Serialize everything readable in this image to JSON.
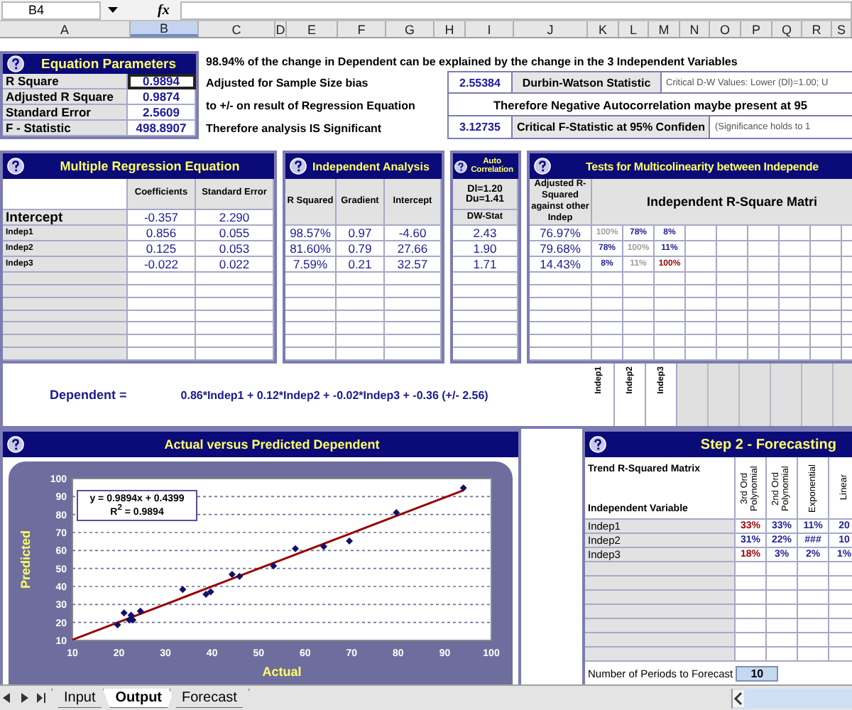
{
  "formula_bar": {
    "name_box": "B4",
    "function_label": "fx"
  },
  "column_headers": [
    {
      "label": "A",
      "selected": false
    },
    {
      "label": "B",
      "selected": true
    },
    {
      "label": "C",
      "selected": false
    },
    {
      "label": "D",
      "selected": false
    },
    {
      "label": "E",
      "selected": false
    },
    {
      "label": "F",
      "selected": false
    },
    {
      "label": "G",
      "selected": false
    },
    {
      "label": "H",
      "selected": false
    },
    {
      "label": "I",
      "selected": false
    },
    {
      "label": "J",
      "selected": false
    },
    {
      "label": "K",
      "selected": false
    },
    {
      "label": "L",
      "selected": false
    },
    {
      "label": "M",
      "selected": false
    },
    {
      "label": "N",
      "selected": false
    },
    {
      "label": "O",
      "selected": false
    },
    {
      "label": "P",
      "selected": false
    },
    {
      "label": "Q",
      "selected": false
    },
    {
      "label": "R",
      "selected": false
    },
    {
      "label": "S",
      "selected": false
    }
  ],
  "equation_parameters": {
    "title": "Equation Parameters",
    "rows": [
      {
        "label": "R Square",
        "value": "0.9894",
        "selected": true
      },
      {
        "label": "Adjusted R Square",
        "value": "0.9874",
        "selected": false
      },
      {
        "label": "Standard Error",
        "value": "2.5609",
        "selected": false
      },
      {
        "label": "F - Statistic",
        "value": "498.8907",
        "selected": false
      }
    ]
  },
  "interpretation": {
    "summary": "98.94% of the change in Dependent can be explained by the change in the 3 Independent Variables",
    "notes": [
      "Adjusted for Sample Size bias",
      "to +/- on result of Regression Equation",
      "Therefore analysis IS Significant"
    ]
  },
  "statistics": {
    "durbin_watson": {
      "value": "2.55384",
      "label": "Durbin-Watson Statistic",
      "note": "Critical D-W Values: Lower (Dl)=1.00; U"
    },
    "autocorrelation_note": "Therefore Negative Autocorrelation maybe present at 95",
    "f_statistic": {
      "value": "3.12735",
      "label": "Critical F-Statistic at 95% Confiden",
      "note": "(Significance holds to 1"
    }
  },
  "regression": {
    "title": "Multiple Regression Equation",
    "columns": [
      "Coefficients",
      "Standard Error"
    ],
    "rows": [
      {
        "kind": "intercept",
        "label": "Intercept",
        "values": [
          "-0.357",
          "2.290"
        ]
      },
      {
        "kind": "variable",
        "label": "Indep1",
        "values": [
          "0.856",
          "0.055"
        ]
      },
      {
        "kind": "variable",
        "label": "Indep2",
        "values": [
          "0.125",
          "0.053"
        ]
      },
      {
        "kind": "variable",
        "label": "Indep3",
        "values": [
          "-0.022",
          "0.022"
        ]
      }
    ]
  },
  "independent_analysis": {
    "title": "Independent Analysis",
    "columns": [
      "R Squared",
      "Gradient",
      "Intercept"
    ],
    "rows": [
      [
        "98.57%",
        "0.97",
        "-4.60"
      ],
      [
        "81.60%",
        "0.79",
        "27.66"
      ],
      [
        "7.59%",
        "0.21",
        "32.57"
      ]
    ]
  },
  "auto_correlation": {
    "title": "Auto Correlation",
    "bounds": [
      "Dl=1.20",
      "Du=1.41"
    ],
    "column": "DW-Stat",
    "rows": [
      "2.43",
      "1.90",
      "1.71"
    ]
  },
  "multicolinearity": {
    "title": "Tests for Multicolinearity between Independe",
    "adjusted_column": "Adjusted R-Squared against other Indep",
    "matrix_title": "Independent R-Square Matri",
    "rows": [
      {
        "adjusted": "76.97%",
        "cells": [
          {
            "text": "100%",
            "color": "#a0a0a0"
          },
          {
            "text": "78%",
            "color": "#2020a0"
          },
          {
            "text": "8%",
            "color": "#2020a0"
          }
        ]
      },
      {
        "adjusted": "79.68%",
        "cells": [
          {
            "text": "78%",
            "color": "#2020a0"
          },
          {
            "text": "100%",
            "color": "#a0a0a0"
          },
          {
            "text": "11%",
            "color": "#2020a0"
          }
        ]
      },
      {
        "adjusted": "14.43%",
        "cells": [
          {
            "text": "8%",
            "color": "#2020a0"
          },
          {
            "text": "11%",
            "color": "#a0a0a0"
          },
          {
            "text": "100%",
            "color": "#990000"
          }
        ]
      }
    ],
    "column_labels": [
      "Indep1",
      "Indep2",
      "Indep3"
    ]
  },
  "equation": {
    "label": "Dependent =",
    "formula": "0.86*Indep1 + 0.12*Indep2 + -0.02*Indep3 + -0.36 (+/- 2.56)"
  },
  "chart_panel": {
    "title": "Actual versus Predicted Dependent",
    "chart_data": {
      "type": "scatter",
      "xlabel": "Actual",
      "ylabel": "Predicted",
      "x": [
        10,
        19.7,
        21.1,
        22.2,
        22.6,
        23.0,
        24.6,
        33.7,
        38.7,
        39.7,
        44.3,
        45.9,
        53.2,
        57.9,
        64.0,
        69.5,
        79.6,
        94.0
      ],
      "series": [
        {
          "color": "#10106a",
          "values": [
            null,
            18.7,
            25.3,
            21.3,
            24.0,
            21.3,
            26.3,
            38.3,
            35.7,
            37.0,
            46.7,
            45.6,
            51.4,
            61.0,
            62.2,
            65.3,
            81.1,
            94.8
          ]
        },
        {
          "type": "line",
          "color": "#990000",
          "values": [
            10.33,
            19.93,
            21.32,
            22.4,
            22.8,
            23.2,
            24.78,
            33.78,
            38.73,
            39.72,
            44.27,
            45.85,
            53.08,
            57.73,
            63.76,
            69.2,
            79.2,
            93.44
          ]
        }
      ],
      "grid": true,
      "xlim": [
        10,
        100
      ],
      "ylim": [
        10,
        100
      ],
      "xticks": [
        10,
        20,
        30,
        40,
        50,
        60,
        70,
        80,
        90,
        100
      ],
      "yticks": [
        10,
        20,
        30,
        40,
        50,
        60,
        70,
        80,
        90,
        100
      ],
      "annotations": [
        {
          "text": "y = 0.9894x + 0.4399"
        },
        {
          "text": "R$^{2}$ = 0.9894"
        }
      ]
    }
  },
  "forecasting": {
    "title": "Step 2 - Forecasting",
    "matrix_title": "Trend R-Squared Matrix",
    "row_header": "Independent Variable",
    "columns": [
      "3rd Ord Polynomial",
      "2nd Ord Polynomial",
      "Exponential",
      "Linear"
    ],
    "rows": [
      {
        "label": "Indep1",
        "cells": [
          {
            "text": "33%",
            "color": "#aa0000"
          },
          {
            "text": "33%",
            "color": "#2020a0"
          },
          {
            "text": "11%",
            "color": "#2020a0"
          },
          {
            "text": "20",
            "color": "#2020a0"
          }
        ]
      },
      {
        "label": "Indep2",
        "cells": [
          {
            "text": "31%",
            "color": "#2020a0"
          },
          {
            "text": "22%",
            "color": "#2020a0"
          },
          {
            "text": "###",
            "color": "#2020a0"
          },
          {
            "text": "10",
            "color": "#2020a0"
          }
        ]
      },
      {
        "label": "Indep3",
        "cells": [
          {
            "text": "18%",
            "color": "#aa0000"
          },
          {
            "text": "3%",
            "color": "#2020a0"
          },
          {
            "text": "2%",
            "color": "#2020a0"
          },
          {
            "text": "1%",
            "color": "#2020a0"
          }
        ]
      }
    ],
    "periods": {
      "label": "Number of Periods to Forecast",
      "value": "10"
    }
  },
  "tabs": [
    {
      "label": "Input",
      "selected": false
    },
    {
      "label": "Output",
      "selected": true
    },
    {
      "label": "Forecast",
      "selected": false
    }
  ]
}
